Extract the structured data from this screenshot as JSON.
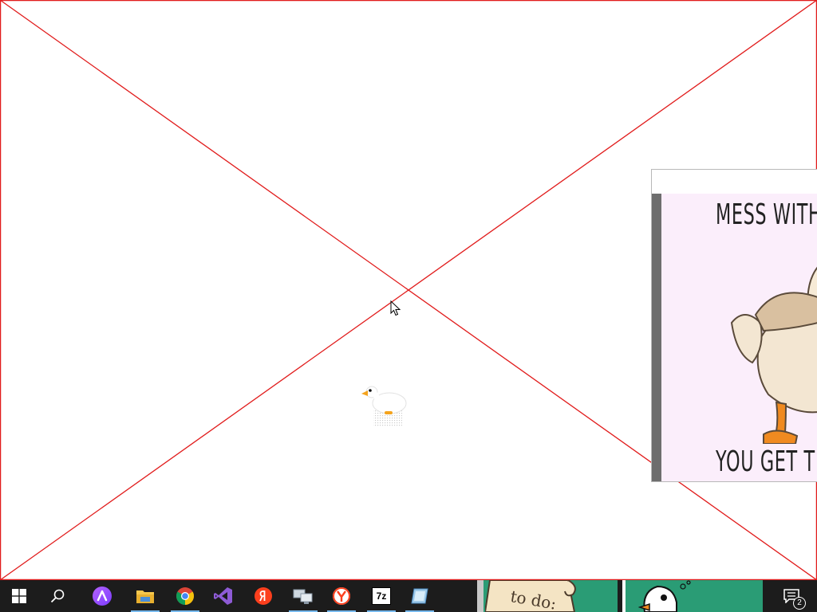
{
  "desktop": {
    "placeholder_color": "#e11b1b"
  },
  "meme_window": {
    "top_text": "MESS WITH T",
    "bottom_text": "YOU GET T",
    "background_color": "#fbeefb"
  },
  "taskbar": {
    "background_color": "#1c1c1c",
    "buttons": [
      {
        "name": "start",
        "icon": "windows-logo-icon"
      },
      {
        "name": "search",
        "icon": "search-icon"
      },
      {
        "name": "alice",
        "icon": "alice-assistant-icon"
      },
      {
        "name": "file-explorer",
        "icon": "folder-icon",
        "running": true
      },
      {
        "name": "chrome",
        "icon": "chrome-icon",
        "running": true
      },
      {
        "name": "visual-studio",
        "icon": "visual-studio-icon"
      },
      {
        "name": "yandex",
        "icon": "yandex-icon"
      },
      {
        "name": "network-app",
        "icon": "computer-network-icon",
        "running": true
      },
      {
        "name": "yandex-browser",
        "icon": "yandex-browser-icon",
        "running": true
      },
      {
        "name": "7zip",
        "icon": "7zip-icon",
        "label": "7z",
        "running": true
      },
      {
        "name": "app-window",
        "icon": "app-window-icon",
        "running": true
      }
    ],
    "thumbnails": [
      {
        "name": "todo-note",
        "text": "to do:"
      },
      {
        "name": "goose-face"
      }
    ],
    "notifications": {
      "icon": "notification-center-icon",
      "count": "2"
    }
  }
}
